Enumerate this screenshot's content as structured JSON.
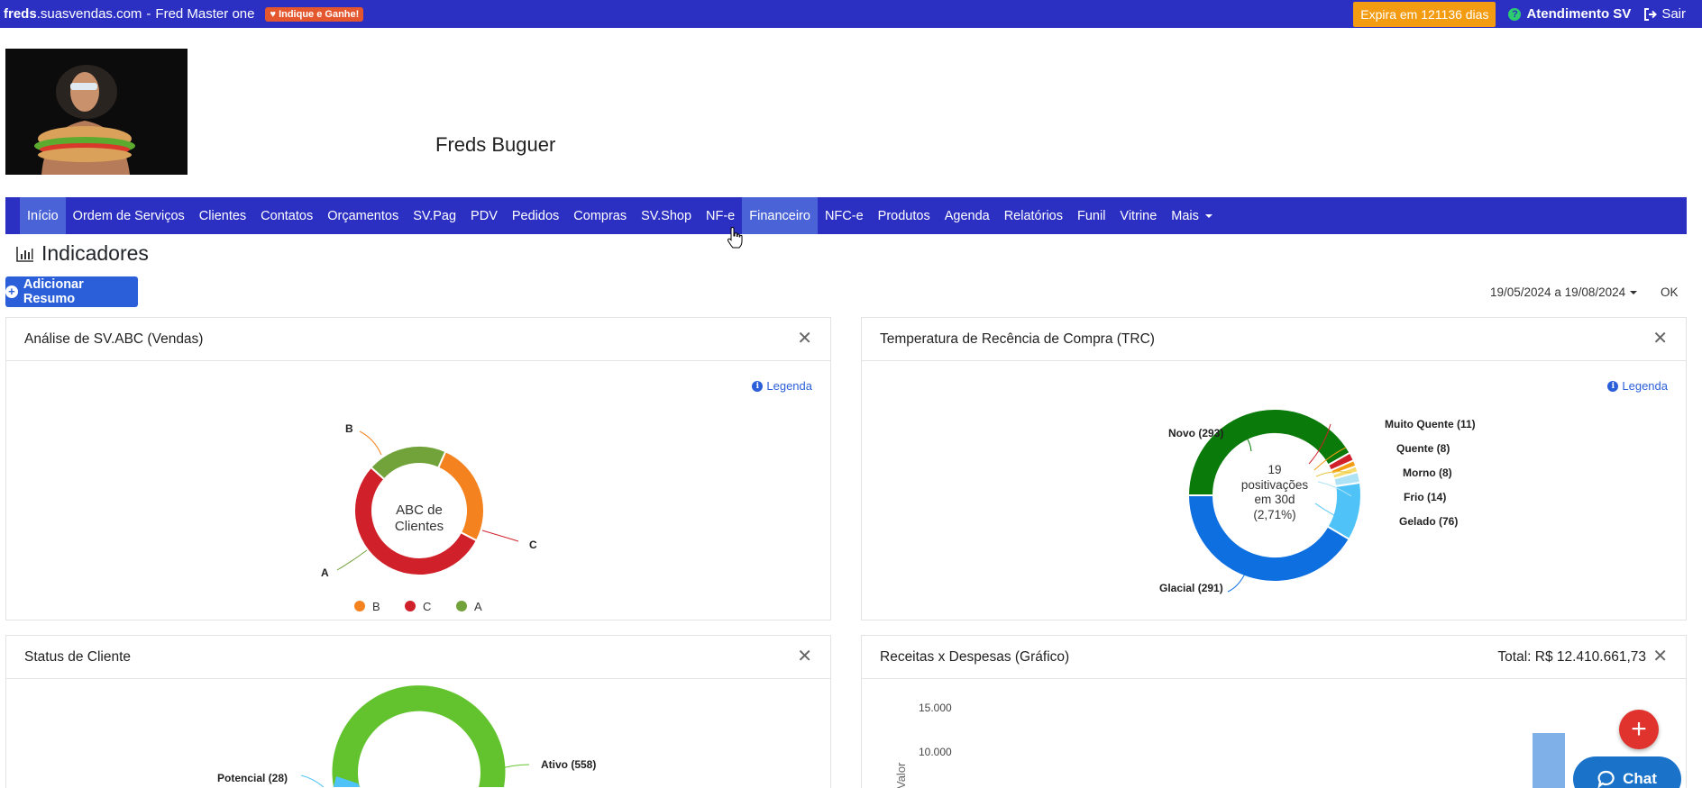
{
  "topbar": {
    "brand_bold": "freds",
    "brand_rest": ".suasvendas.com",
    "account": "Fred Master one",
    "indique": "Indique e Ganhe!",
    "expira": "Expira em 121136 dias",
    "atendimento": "Atendimento SV",
    "sair": "Sair"
  },
  "header": {
    "company": "Freds Buguer"
  },
  "nav": [
    {
      "label": "Início",
      "state": "active"
    },
    {
      "label": "Ordem de Serviços"
    },
    {
      "label": "Clientes"
    },
    {
      "label": "Contatos"
    },
    {
      "label": "Orçamentos"
    },
    {
      "label": "SV.Pag"
    },
    {
      "label": "PDV"
    },
    {
      "label": "Pedidos"
    },
    {
      "label": "Compras"
    },
    {
      "label": "SV.Shop"
    },
    {
      "label": "NF-e"
    },
    {
      "label": "Financeiro",
      "state": "hover"
    },
    {
      "label": "NFC-e"
    },
    {
      "label": "Produtos"
    },
    {
      "label": "Agenda"
    },
    {
      "label": "Relatórios"
    },
    {
      "label": "Funil"
    },
    {
      "label": "Vitrine"
    },
    {
      "label": "Mais"
    }
  ],
  "indicadores": {
    "title": "Indicadores",
    "add_button": "Adicionar Resumo",
    "date_range": "19/05/2024 a 19/08/2024",
    "ok": "OK"
  },
  "cards": {
    "abc": {
      "title": "Análise de SV.ABC (Vendas)",
      "legenda": "Legenda",
      "center_line1": "ABC de",
      "center_line2": "Clientes",
      "segments": [
        {
          "label": "B",
          "value": 26,
          "color": "#f4831f"
        },
        {
          "label": "C",
          "value": 54,
          "color": "#d0202a"
        },
        {
          "label": "A",
          "value": 20,
          "color": "#72a33a"
        }
      ]
    },
    "trc": {
      "title": "Temperatura de Recência de Compra (TRC)",
      "legenda": "Legenda",
      "center_lines": [
        "19",
        "positivações",
        "em 30d",
        "(2,71%)"
      ],
      "segments": [
        {
          "label": "Novo (293)",
          "value": 293,
          "color": "#0a7a0a"
        },
        {
          "label": "Muito Quente (11)",
          "value": 11,
          "color": "#d0202a"
        },
        {
          "label": "Quente (8)",
          "value": 8,
          "color": "#f39c12"
        },
        {
          "label": "Morno (8)",
          "value": 8,
          "color": "#f7dc6f"
        },
        {
          "label": "Frio (14)",
          "value": 14,
          "color": "#aee3f5"
        },
        {
          "label": "Gelado (76)",
          "value": 76,
          "color": "#4fc3f7"
        },
        {
          "label": "Glacial (291)",
          "value": 291,
          "color": "#0d6fe0"
        }
      ]
    },
    "status": {
      "title": "Status de Cliente",
      "labels": {
        "potencial": "Potencial (28)",
        "ativo": "Ativo (558)"
      },
      "color": "#63c32e"
    },
    "receitas": {
      "title": "Receitas x Despesas (Gráfico)",
      "total": "Total: R$ 12.410.661,73",
      "y_ticks": [
        "15.000",
        "10.000"
      ],
      "y_label": "Valor"
    }
  },
  "chat": {
    "label": "Chat"
  }
}
